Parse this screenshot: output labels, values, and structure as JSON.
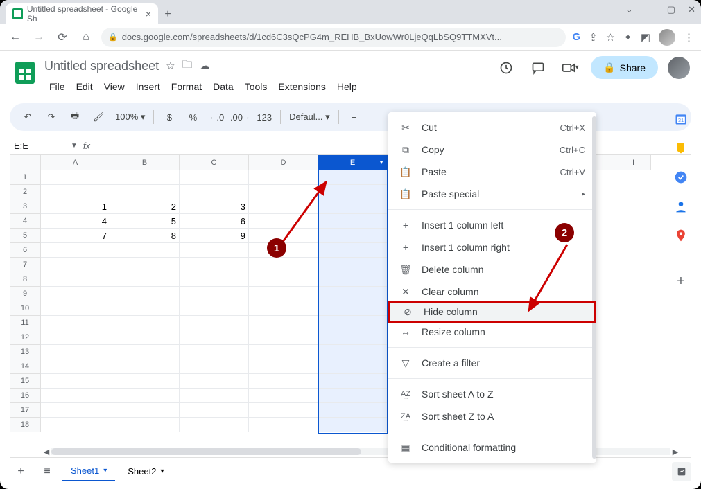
{
  "browser": {
    "tab_title": "Untitled spreadsheet - Google Sh",
    "url": "docs.google.com/spreadsheets/d/1cd6C3sQcPG4m_REHB_BxUowWr0LjeQqLbSQ9TTMXVt..."
  },
  "sheets": {
    "title": "Untitled spreadsheet",
    "menus": [
      "File",
      "Edit",
      "View",
      "Insert",
      "Format",
      "Data",
      "Tools",
      "Extensions",
      "Help"
    ],
    "share": "Share",
    "zoom": "100%",
    "font": "Defaul...",
    "namebox": "E:E"
  },
  "toolbar": {
    "currency": "$",
    "percent": "%",
    "dec_dec": ".0",
    "inc_dec": ".00",
    "num_fmt": "123",
    "minus": "−"
  },
  "columns": [
    "A",
    "B",
    "C",
    "D",
    "E",
    "I"
  ],
  "selected_col": "E",
  "rows": [
    "1",
    "2",
    "3",
    "4",
    "5",
    "6",
    "7",
    "8",
    "9",
    "10",
    "11",
    "12",
    "13",
    "14",
    "15",
    "16",
    "17",
    "18"
  ],
  "grid": {
    "r3": {
      "A": "1",
      "B": "2",
      "C": "3"
    },
    "r4": {
      "A": "4",
      "B": "5",
      "C": "6"
    },
    "r5": {
      "A": "7",
      "B": "8",
      "C": "9"
    }
  },
  "ctx": {
    "cut": "Cut",
    "cut_k": "Ctrl+X",
    "copy": "Copy",
    "copy_k": "Ctrl+C",
    "paste": "Paste",
    "paste_k": "Ctrl+V",
    "paste_special": "Paste special",
    "insert_left": "Insert 1 column left",
    "insert_right": "Insert 1 column right",
    "delete": "Delete column",
    "clear": "Clear column",
    "hide": "Hide column",
    "resize": "Resize column",
    "filter": "Create a filter",
    "sort_az": "Sort sheet A to Z",
    "sort_za": "Sort sheet Z to A",
    "cond_fmt": "Conditional formatting"
  },
  "sheet_tabs": [
    "Sheet1",
    "Sheet2"
  ],
  "annot": {
    "one": "1",
    "two": "2"
  }
}
